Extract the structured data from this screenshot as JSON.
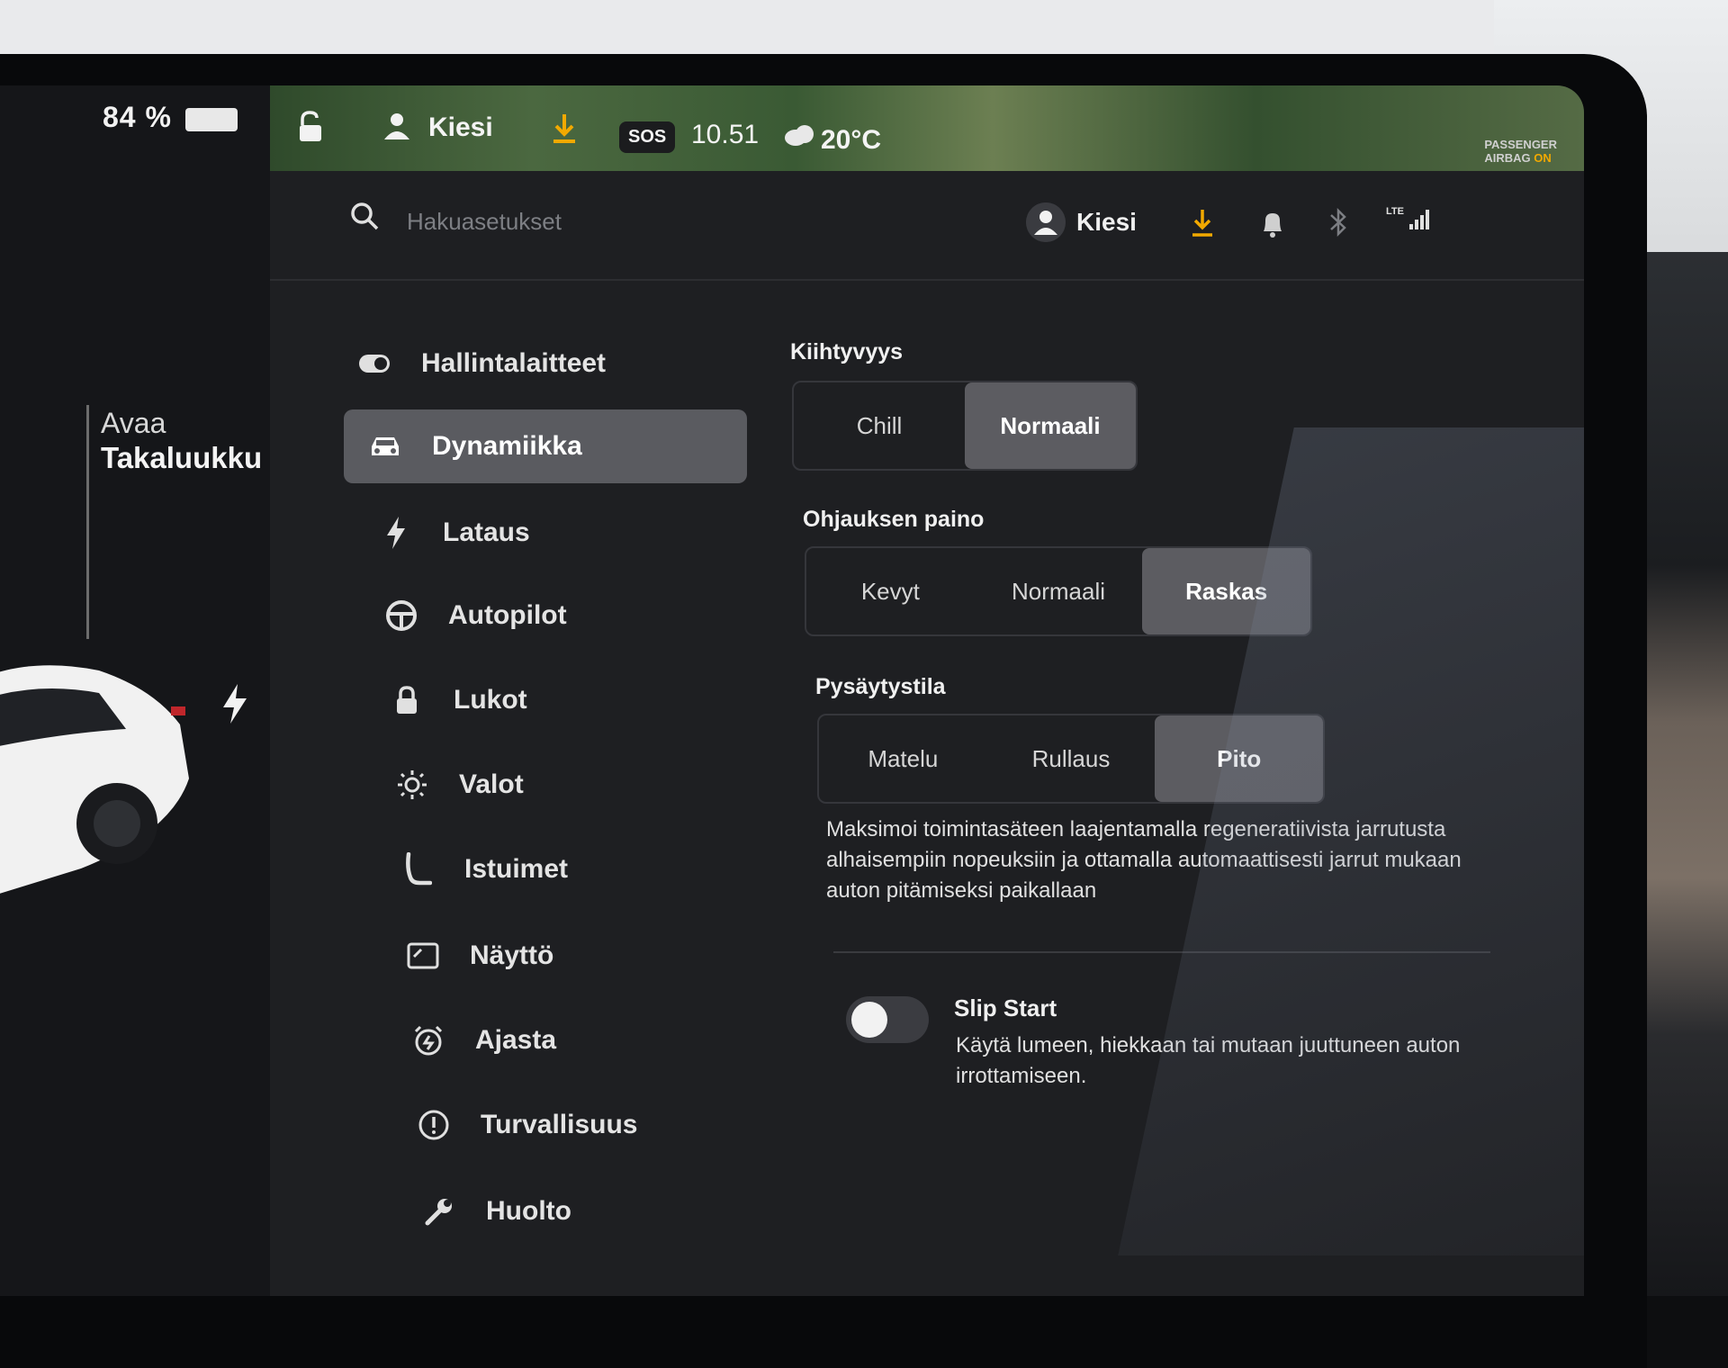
{
  "cluster": {
    "battery_percent": "84 %",
    "trunk_label_line1": "Avaa",
    "trunk_label_line2": "Takaluukku"
  },
  "status_bar": {
    "profile_name": "Kiesi",
    "sos_label": "SOS",
    "time": "10.51",
    "temperature": "20°C",
    "airbag_line1": "PASSENGER",
    "airbag_line2_prefix": "AIRBAG",
    "airbag_line2_state": "ON"
  },
  "topbar": {
    "search_placeholder": "Hakuasetukset",
    "profile_name": "Kiesi",
    "lte_label": "LTE"
  },
  "sidebar": {
    "items": [
      {
        "label": "Hallintalaitteet",
        "icon": "toggle-icon"
      },
      {
        "label": "Dynamiikka",
        "icon": "car-icon",
        "active": true
      },
      {
        "label": "Lataus",
        "icon": "bolt-icon"
      },
      {
        "label": "Autopilot",
        "icon": "steering-wheel-icon"
      },
      {
        "label": "Lukot",
        "icon": "lock-icon"
      },
      {
        "label": "Valot",
        "icon": "sun-icon"
      },
      {
        "label": "Istuimet",
        "icon": "seat-icon"
      },
      {
        "label": "Näyttö",
        "icon": "display-icon"
      },
      {
        "label": "Ajasta",
        "icon": "alarm-clock-icon"
      },
      {
        "label": "Turvallisuus",
        "icon": "info-circle-icon"
      },
      {
        "label": "Huolto",
        "icon": "wrench-icon"
      }
    ]
  },
  "dynamics": {
    "acceleration": {
      "label": "Kiihtyvyys",
      "options": [
        "Chill",
        "Normaali"
      ],
      "selected": "Normaali"
    },
    "steering": {
      "label": "Ohjauksen paino",
      "options": [
        "Kevyt",
        "Normaali",
        "Raskas"
      ],
      "selected": "Raskas"
    },
    "stopping": {
      "label": "Pysäytystila",
      "options": [
        "Matelu",
        "Rullaus",
        "Pito"
      ],
      "selected": "Pito",
      "description": "Maksimoi toimintasäteen laajentamalla regeneratiivista jarrutusta alhaisempiin nopeuksiin ja ottamalla automaattisesti jarrut mukaan auton pitämiseksi paikallaan"
    },
    "slip_start": {
      "label": "Slip Start",
      "description": "Käytä lumeen, hiekkaan tai mutaan juuttuneen auton irrottamiseen.",
      "enabled": false
    }
  },
  "colors": {
    "accent_download": "#f2a900",
    "selected_segment": "#5c5c61",
    "active_nav": "#5a5b60"
  }
}
